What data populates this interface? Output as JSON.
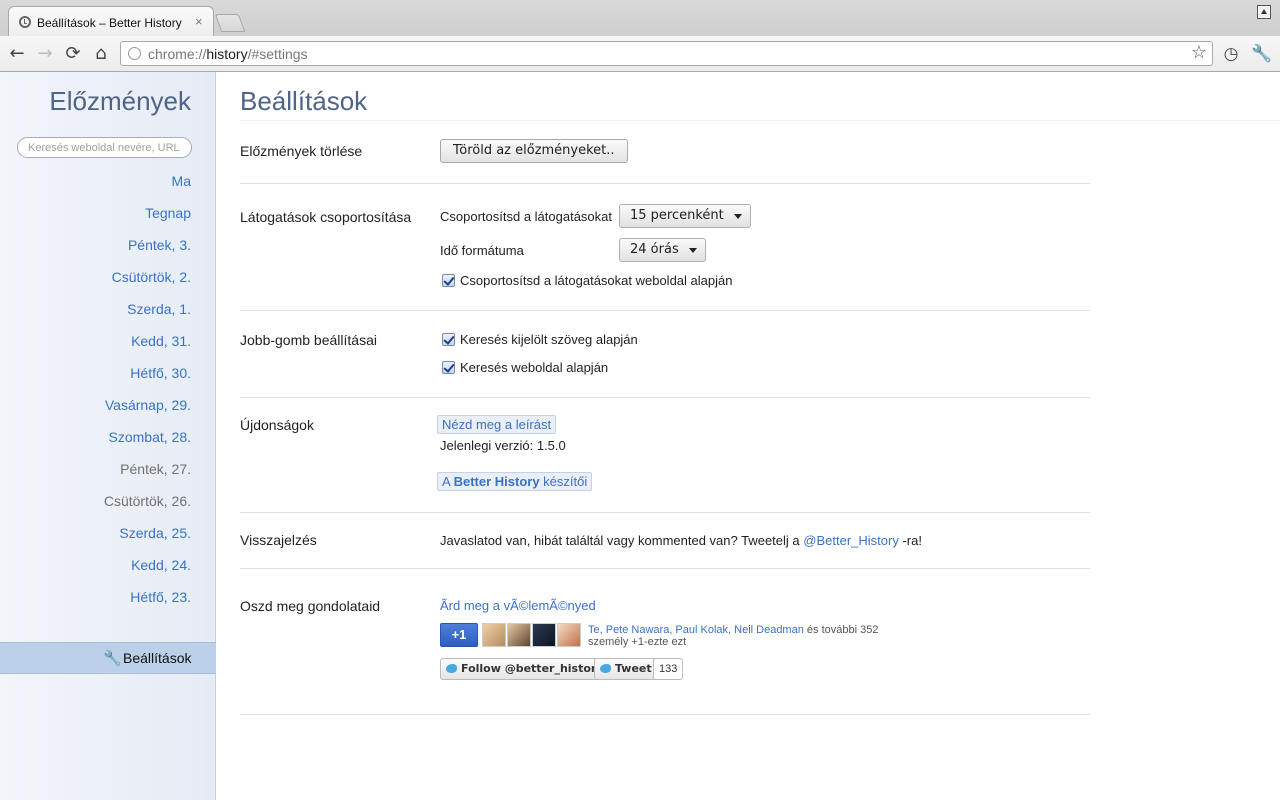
{
  "browser": {
    "tab_title": "Beállítások – Better History",
    "tab_close": "×",
    "url_prefix": "chrome://",
    "url_host": "history",
    "url_path": "/#settings",
    "icons": [
      "back-arrow-icon",
      "forward-arrow-icon",
      "reload-icon",
      "home-icon",
      "star-icon",
      "history-clock-icon",
      "wrench-icon"
    ]
  },
  "sidebar": {
    "title": "Előzmények",
    "search_placeholder": "Keresés weboldal nevére, URL",
    "days": [
      {
        "label": "Ma",
        "muted": false
      },
      {
        "label": "Tegnap",
        "muted": false
      },
      {
        "label": "Péntek, 3.",
        "muted": false
      },
      {
        "label": "Csütörtök, 2.",
        "muted": false
      },
      {
        "label": "Szerda, 1.",
        "muted": false
      },
      {
        "label": "Kedd, 31.",
        "muted": false
      },
      {
        "label": "Hétfő, 30.",
        "muted": false
      },
      {
        "label": "Vasárnap, 29.",
        "muted": false
      },
      {
        "label": "Szombat, 28.",
        "muted": false
      },
      {
        "label": "Péntek, 27.",
        "muted": true
      },
      {
        "label": "Csütörtök, 26.",
        "muted": true
      },
      {
        "label": "Szerda, 25.",
        "muted": false
      },
      {
        "label": "Kedd, 24.",
        "muted": false
      },
      {
        "label": "Hétfő, 23.",
        "muted": false
      }
    ],
    "settings_label": "Beállítások"
  },
  "main": {
    "title": "Beállítások",
    "clear_history": {
      "label": "Előzmények törlése",
      "button": "Töröld az előzményeket.."
    },
    "grouping": {
      "label": "Látogatások csoportosítása",
      "group_by_label": "Csoportosítsd a látogatásokat",
      "group_by_value": "15 percenként",
      "time_format_label": "Idő formátuma",
      "time_format_value": "24 órás",
      "domain_grouping_label": "Csoportosítsd a látogatásokat weboldal alapján",
      "domain_grouping_checked": true
    },
    "right_click": {
      "label": "Jobb-gomb beállításai",
      "search_selection_label": "Keresés kijelölt szöveg alapján",
      "search_selection_checked": true,
      "search_domain_label": "Keresés weboldal alapján",
      "search_domain_checked": true
    },
    "whats_new": {
      "label": "Újdonságok",
      "changelog_link": "Nézd meg a leírást",
      "version_text": "Jelenlegi verzió: 1.5.0",
      "credits_prefix": "A ",
      "credits_bold": "Better History",
      "credits_suffix": " készítői"
    },
    "feedback": {
      "label": "Visszajelzés",
      "text_before": "Javaslatod van, hibát találtál vagy kommented van? Tweetelj a ",
      "handle": "@Better_History",
      "text_after": " -ra!"
    },
    "share": {
      "label": "Oszd meg gondolataid",
      "review_link": "Ãrd meg a vÃ©lemÃ©nyed",
      "plusone_label": "+1",
      "names": "Te, Pete Nawara, Paul Kolak, Neil Deadman",
      "names_suffix": " és további 352",
      "line2": "személy +1-ezte ezt",
      "follow_button": "Follow @better_history",
      "tweet_button": "Tweet",
      "tweet_count": "133"
    }
  }
}
